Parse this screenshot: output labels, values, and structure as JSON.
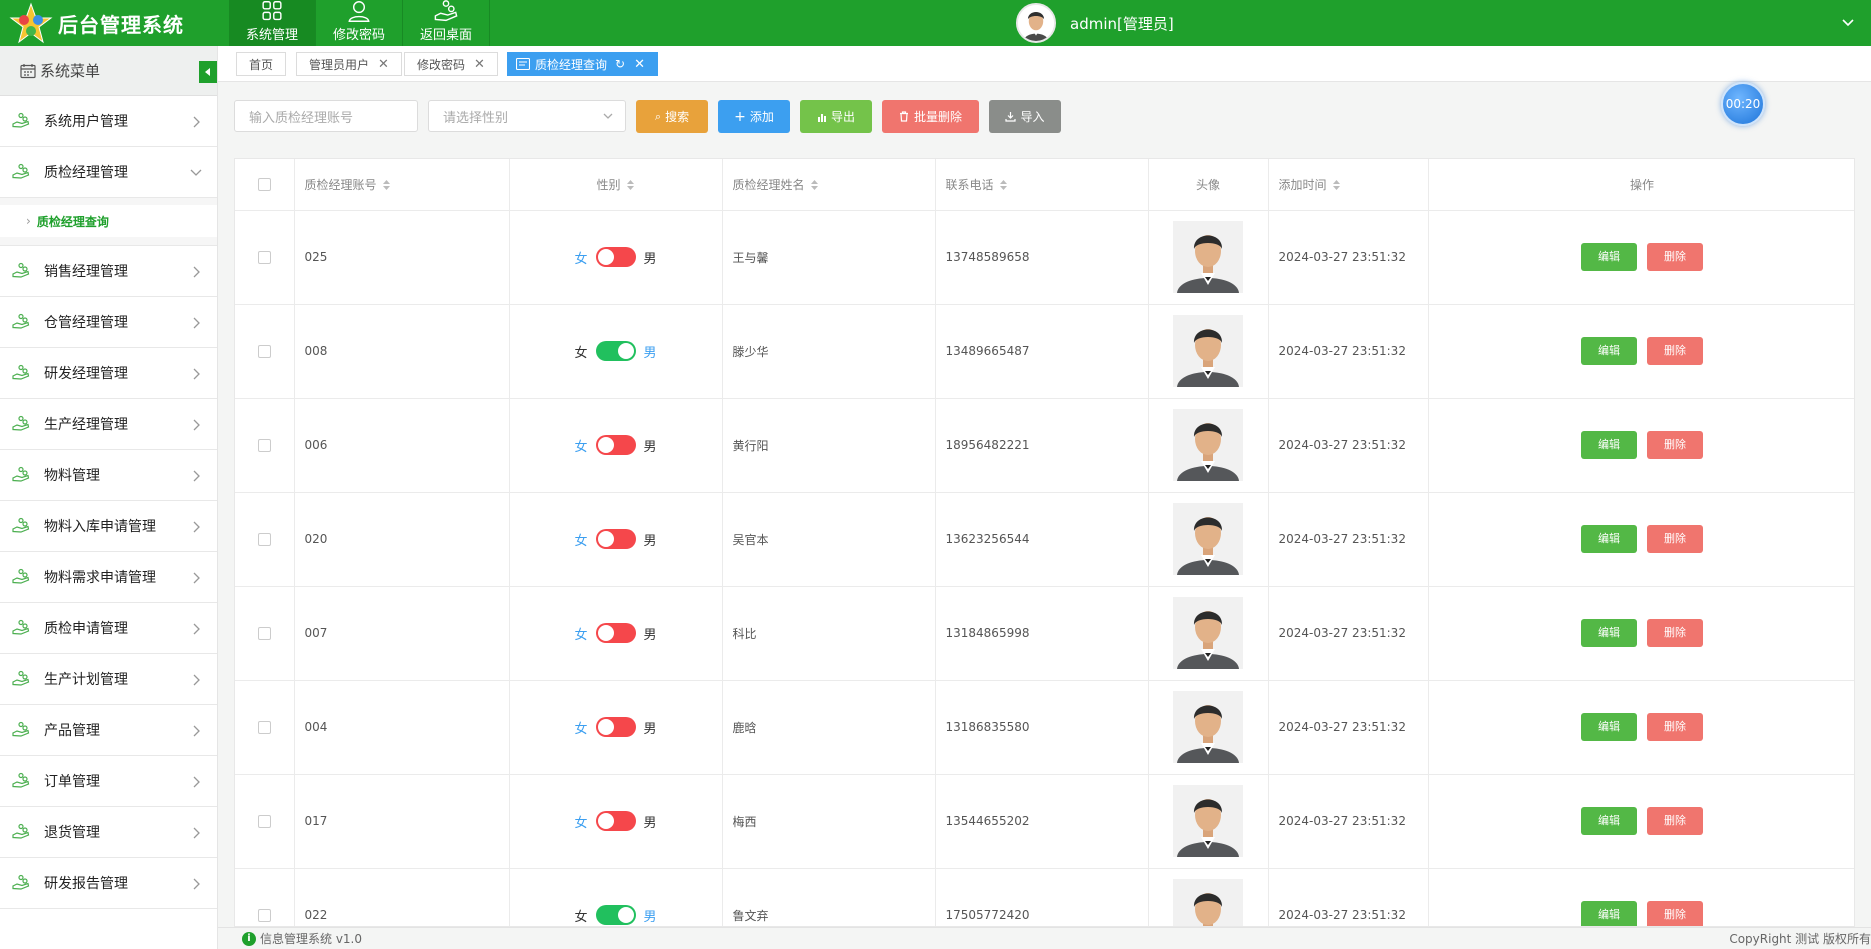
{
  "app": {
    "title": "后台管理系统"
  },
  "topnav": [
    {
      "label": "系统管理",
      "icon": "grid-icon",
      "active": true
    },
    {
      "label": "修改密码",
      "icon": "user-icon",
      "active": false
    },
    {
      "label": "返回桌面",
      "icon": "hand-coin-icon",
      "active": false
    }
  ],
  "user": {
    "name": "admin[管理员]"
  },
  "sidebar": {
    "title": "系统菜单",
    "items_before": [
      {
        "label": "系统用户管理"
      },
      {
        "label": "质检经理管理",
        "expanded": true
      }
    ],
    "submenu": [
      {
        "label": "质检经理查询"
      }
    ],
    "items_after": [
      {
        "label": "销售经理管理"
      },
      {
        "label": "仓管经理管理"
      },
      {
        "label": "研发经理管理"
      },
      {
        "label": "生产经理管理"
      },
      {
        "label": "物料管理"
      },
      {
        "label": "物料入库申请管理"
      },
      {
        "label": "物料需求申请管理"
      },
      {
        "label": "质检申请管理"
      },
      {
        "label": "生产计划管理"
      },
      {
        "label": "产品管理"
      },
      {
        "label": "订单管理"
      },
      {
        "label": "退货管理"
      },
      {
        "label": "研发报告管理"
      }
    ]
  },
  "tabs": [
    {
      "label": "首页",
      "closable": false,
      "active": false
    },
    {
      "label": "管理员用户",
      "closable": true,
      "active": false
    },
    {
      "label": "修改密码",
      "closable": true,
      "active": false
    },
    {
      "label": "质检经理查询",
      "closable": true,
      "active": true
    }
  ],
  "toolbar": {
    "account_placeholder": "输入质检经理账号",
    "gender_placeholder": "请选择性别",
    "search": "搜索",
    "add": "添加",
    "export": "导出",
    "batch_delete": "批量删除",
    "import": "导入"
  },
  "timer": "00:20",
  "table": {
    "headers": {
      "account": "质检经理账号",
      "gender": "性别",
      "name": "质检经理姓名",
      "phone": "联系电话",
      "avatar": "头像",
      "added": "添加时间",
      "ops": "操作"
    },
    "female": "女",
    "male": "男",
    "edit": "编辑",
    "delete": "删除",
    "rows": [
      {
        "account": "025",
        "gender": "女",
        "name": "王与馨",
        "phone": "13748589658",
        "added": "2024-03-27 23:51:32"
      },
      {
        "account": "008",
        "gender": "男",
        "name": "滕少华",
        "phone": "13489665487",
        "added": "2024-03-27 23:51:32"
      },
      {
        "account": "006",
        "gender": "女",
        "name": "黄行阳",
        "phone": "18956482221",
        "added": "2024-03-27 23:51:32"
      },
      {
        "account": "020",
        "gender": "女",
        "name": "吴官本",
        "phone": "13623256544",
        "added": "2024-03-27 23:51:32"
      },
      {
        "account": "007",
        "gender": "女",
        "name": "科比",
        "phone": "13184865998",
        "added": "2024-03-27 23:51:32"
      },
      {
        "account": "004",
        "gender": "女",
        "name": "鹿晗",
        "phone": "13186835580",
        "added": "2024-03-27 23:51:32"
      },
      {
        "account": "017",
        "gender": "女",
        "name": "梅西",
        "phone": "13544655202",
        "added": "2024-03-27 23:51:32"
      },
      {
        "account": "022",
        "gender": "男",
        "name": "鲁文弃",
        "phone": "17505772420",
        "added": "2024-03-27 23:51:32"
      }
    ]
  },
  "footer": {
    "left": "信息管理系统 v1.0",
    "right": "CopyRight   测试 版权所有"
  },
  "colors": {
    "brand": "#1fa02c",
    "primary": "#3c9ff0",
    "warning": "#e8a23b",
    "danger": "#f0756e",
    "switch_on": "#21c05e",
    "switch_off": "#f5474b"
  }
}
